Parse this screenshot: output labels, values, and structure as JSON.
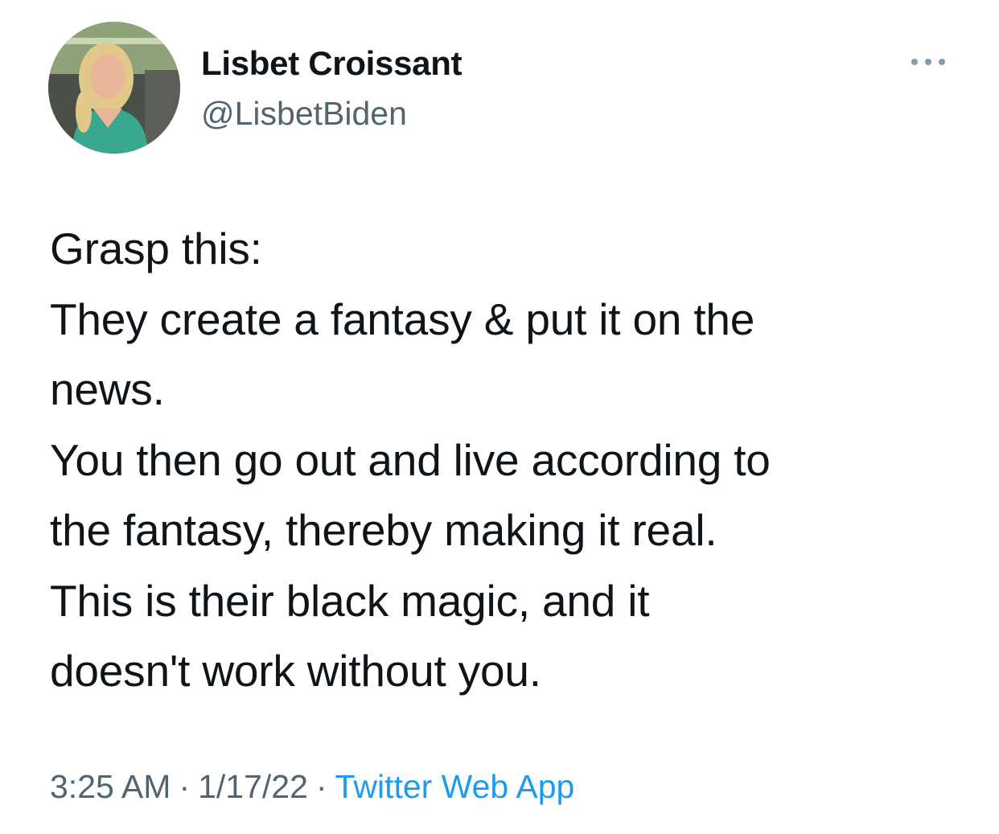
{
  "tweet": {
    "author": {
      "display_name": "Lisbet Croissant",
      "handle": "@LisbetBiden",
      "avatar_icon": "profile-photo"
    },
    "more_icon": "more-horizontal-icon",
    "text_lines": [
      "Grasp this:",
      "They create a fantasy & put it on the",
      "news.",
      "You then go out and live according to",
      "the fantasy, thereby making it real.",
      "This is their black magic, and it",
      "doesn't work without you."
    ],
    "meta": {
      "time": "3:25 AM",
      "separator": "·",
      "date": "1/17/22",
      "source": "Twitter Web App"
    }
  },
  "colors": {
    "text_primary": "#0f1419",
    "text_secondary": "#536471",
    "link": "#1d9bf0",
    "background": "#ffffff"
  }
}
